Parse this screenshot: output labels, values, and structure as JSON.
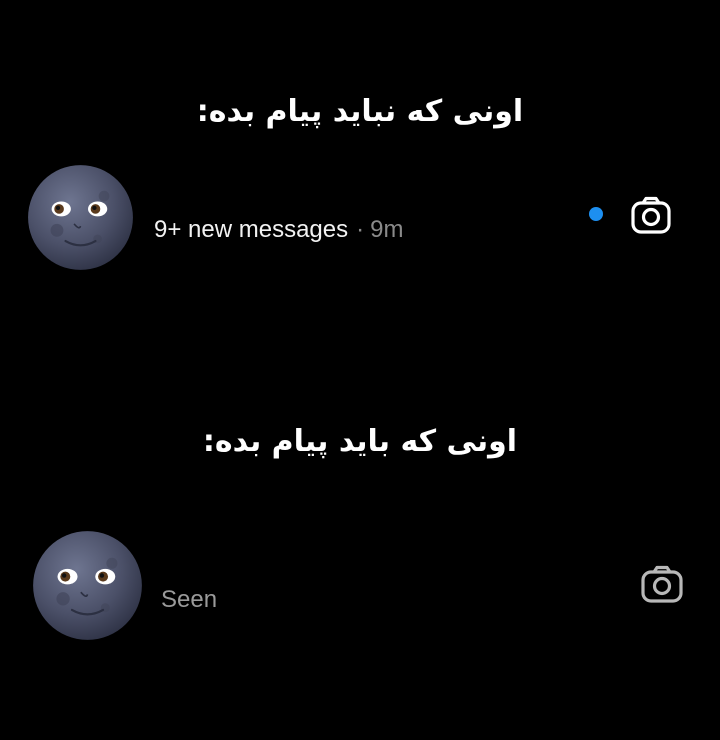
{
  "captions": {
    "top": "اونی که نباید پیام بده:",
    "bottom": "اونی که باید پیام بده:"
  },
  "thread_unwanted": {
    "avatar_icon": "new-moon-face-icon",
    "status_text": "9+ new messages",
    "separator": "·",
    "time": "9m",
    "unread_indicator_color": "#1d8ff0",
    "camera_icon": "camera-icon"
  },
  "thread_wanted": {
    "avatar_icon": "new-moon-face-icon",
    "status_text": "Seen",
    "camera_icon": "camera-icon"
  },
  "colors": {
    "background": "#000000",
    "text_primary": "#f2f2f2",
    "text_secondary": "#8a8a8a",
    "unread_dot": "#1d8ff0"
  }
}
